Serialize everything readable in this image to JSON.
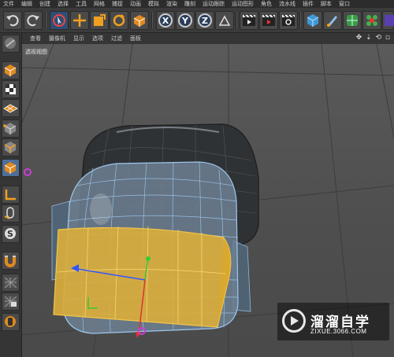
{
  "menu": [
    "文件",
    "编辑",
    "创建",
    "选择",
    "工具",
    "网格",
    "捕捉",
    "动画",
    "模拟",
    "渲染",
    "雕刻",
    "运动跟踪",
    "运动图形",
    "角色",
    "流水线",
    "插件",
    "脚本",
    "窗口"
  ],
  "toolbar": {
    "icons": [
      "undo-icon",
      "redo-icon",
      "live-selection-icon",
      "move-icon",
      "scale-icon",
      "rotate-icon",
      "recent-object-icon",
      "x-axis-icon",
      "y-axis-icon",
      "z-axis-icon",
      "coordinate-system-icon",
      "render-view-icon",
      "render-picture-viewer-icon",
      "render-settings-icon",
      "cube-icon",
      "pen-icon",
      "subdivision-icon",
      "cloner-icon",
      "deformer-icon"
    ],
    "axis_labels": [
      "X",
      "Y",
      "Z"
    ]
  },
  "viewport": {
    "menu": [
      "查看",
      "摄像机",
      "显示",
      "选项",
      "过滤",
      "面板"
    ],
    "nav_glyphs": "✥ ⇣ ⟲ ▫",
    "camera_label": "透视视图"
  },
  "left_tools": [
    "make-editable-icon",
    "texture-mode-icon",
    "workplane-icon",
    "points-mode-icon",
    "edges-mode-icon",
    "polygons-mode-icon",
    "axis-mode-icon",
    "tweak-icon",
    "snap-icon",
    "magnet-icon",
    "lock-icon",
    "layer-icon"
  ],
  "watermark": {
    "title": "溜溜自学",
    "url": "ZIXUE.3066.COM"
  },
  "colors": {
    "selection": "#e7b93a",
    "wire_selected": "#6aa9e8",
    "axis_x": "#d33",
    "axis_y": "#3c3",
    "axis_z": "#35f",
    "magenta_handle": "#c83fd6"
  }
}
